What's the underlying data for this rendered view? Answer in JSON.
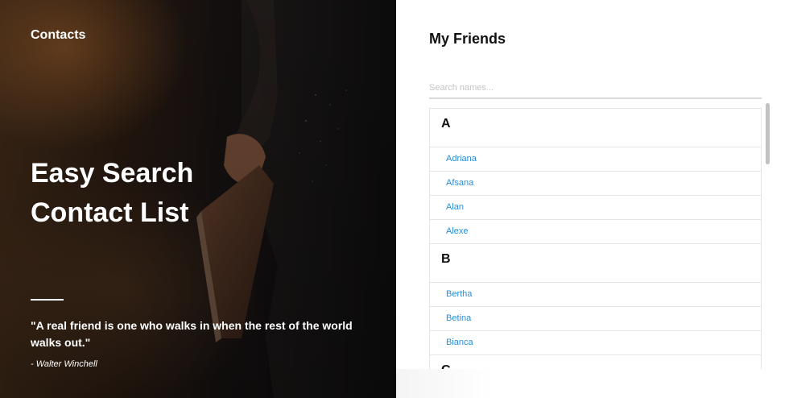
{
  "hero": {
    "brand": "Contacts",
    "headline_line1": "Easy Search",
    "headline_line2": "Contact List",
    "quote": "\"A real friend is one who walks in when the rest of the world walks out.\"",
    "quote_author": "- Walter Winchell"
  },
  "panel": {
    "title": "My Friends",
    "search_placeholder": "Search names...",
    "groups": [
      {
        "letter": "A",
        "contacts": [
          "Adriana",
          "Afsana",
          "Alan",
          "Alexe"
        ]
      },
      {
        "letter": "B",
        "contacts": [
          "Bertha",
          "Betina",
          "Bianca"
        ]
      },
      {
        "letter": "C",
        "contacts": []
      }
    ]
  },
  "colors": {
    "link": "#2a8dd4",
    "border": "#e5e5e5",
    "hero_text": "#ffffff"
  }
}
